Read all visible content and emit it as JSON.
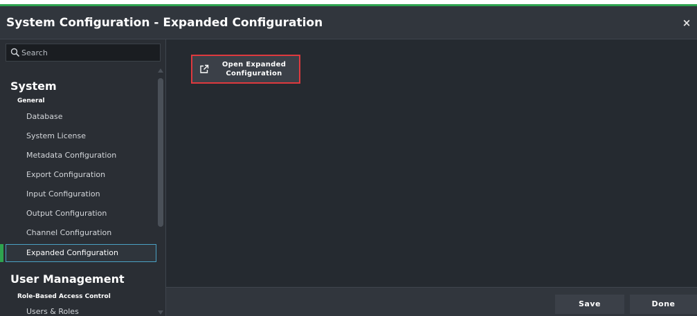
{
  "window": {
    "title": "System Configuration - Expanded Configuration",
    "close_label": "×"
  },
  "search": {
    "placeholder": "Search",
    "value": ""
  },
  "sidebar": {
    "sections": [
      {
        "title": "System",
        "groups": [
          {
            "title": "General",
            "items": [
              {
                "label": "Database"
              },
              {
                "label": "System License"
              },
              {
                "label": "Metadata Configuration"
              },
              {
                "label": "Export Configuration"
              },
              {
                "label": "Input Configuration"
              },
              {
                "label": "Output Configuration"
              },
              {
                "label": "Channel Configuration"
              },
              {
                "label": "Expanded Configuration",
                "selected": true
              }
            ]
          }
        ]
      },
      {
        "title": "User Management",
        "groups": [
          {
            "title": "Role-Based Access Control",
            "items": [
              {
                "label": "Users & Roles"
              }
            ]
          }
        ]
      }
    ]
  },
  "main": {
    "open_button_label": "Open Expanded Configuration",
    "icon": "external-link-icon"
  },
  "footer": {
    "save_label": "Save",
    "done_label": "Done"
  },
  "colors": {
    "accent_green": "#2ea34f",
    "highlight_red": "#e0393e",
    "selection_blue": "#4aa2c5",
    "background": "#252a30"
  }
}
